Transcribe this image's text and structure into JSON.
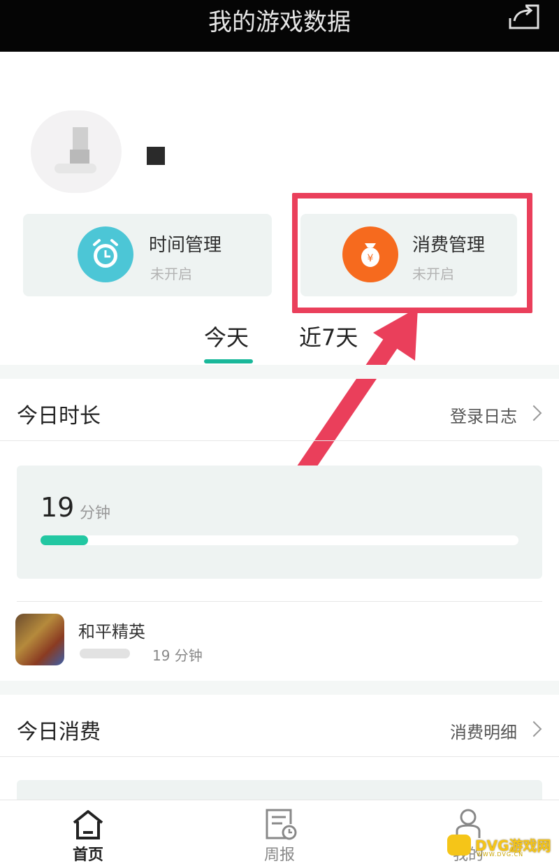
{
  "header": {
    "title": "我的游戏数据",
    "share_icon": "share-icon"
  },
  "profile": {
    "avatar_icon": "avatar-placeholder"
  },
  "controls": {
    "time": {
      "title": "时间管理",
      "status": "未开启",
      "icon": "alarm-clock-icon",
      "color": "#4cc6d6"
    },
    "spend": {
      "title": "消费管理",
      "status": "未开启",
      "icon": "money-bag-icon",
      "color": "#f66a1e"
    }
  },
  "annotation": {
    "highlight_color": "#ea3f5b",
    "arrow": "arrow-icon"
  },
  "tabs": [
    {
      "label": "今天",
      "active": true
    },
    {
      "label": "近7天",
      "active": false
    }
  ],
  "duration": {
    "title": "今日时长",
    "link": "登录日志",
    "total_value": "19",
    "total_unit": "分钟",
    "progress": 0.1,
    "game": {
      "name": "和平精英",
      "time": "19 分钟"
    }
  },
  "spending": {
    "title": "今日消费",
    "link": "消费明细"
  },
  "nav": [
    {
      "label": "首页",
      "icon": "home-icon",
      "active": true
    },
    {
      "label": "周报",
      "icon": "report-icon",
      "active": false
    },
    {
      "label": "我的",
      "icon": "profile-icon",
      "active": false
    }
  ],
  "watermark": {
    "text": "DVG游戏网",
    "sub": "WWW.DVG.CN"
  },
  "accent": "#19b89a"
}
